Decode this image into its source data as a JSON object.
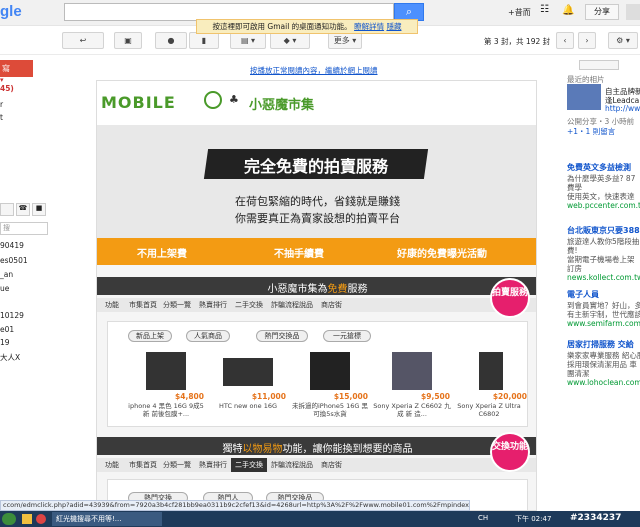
{
  "header": {
    "logo": "gle",
    "plus": "+昔而",
    "share": "分享",
    "search_icon": "search-icon"
  },
  "notice": {
    "text": "按這裡即可啟用 Gmail 的桌面通知功能。",
    "more": "瞭解詳情",
    "hide": "隱藏"
  },
  "toolbar": {
    "more": "更多",
    "range": "第 3 封，共 192 封"
  },
  "left": {
    "compose": "寫",
    "count": "45)",
    "items": [
      "r",
      "t",
      "",
      "90419",
      "es0501",
      "_an",
      "ue",
      "",
      "10129",
      "e01",
      "19",
      "大人X"
    ],
    "search_placeholder": "搜"
  },
  "banner_link": "按播放正常閱讀內容，繼續於網上閱讀",
  "promo": {
    "brand": "MOBILE",
    "brand_sub": "小惡魔市集",
    "hero_title": "完全免費的拍賣服務",
    "hero_line1": "在荷包緊縮的時代，省錢就是賺錢",
    "hero_line2": "你需要真正為賣家設想的拍賣平台",
    "benefits": [
      "不用上架費",
      "不抽手續費",
      "好康的免費曝光活動"
    ],
    "section1_title_pre": "小惡魔市集為",
    "section1_title_hl": "免費",
    "section1_title_post": "服務",
    "section1_badge": "拍賣服務",
    "nav1": [
      "功能",
      "市集首頁",
      "分類一覽",
      "熱賣排行",
      "二手交換",
      "詐騙流程說品",
      "商店街"
    ],
    "tabs": [
      "新品上架",
      "人氣商品",
      "熱門交換品",
      "一元搶標"
    ],
    "products": [
      {
        "price": "$4,800",
        "name": "iphone 4 黑色 16G 9成5新 前後包膜+..."
      },
      {
        "price": "$11,000",
        "name": "HTC new one 16G"
      },
      {
        "price": "$15,000",
        "name": "未拆過的iPhone5 16G 黑可換5s水貨"
      },
      {
        "price": "$9,500",
        "name": "Sony Xperia Z C6602 九成 新 造..."
      },
      {
        "price": "$20,000",
        "name": "Sony Xperia Z Ultra C6802"
      }
    ],
    "section2_title_pre": "獨特",
    "section2_title_hl": "以物易物",
    "section2_title_post": "功能，讓你能換到想要的商品",
    "section2_badge": "交換功能",
    "nav2": [
      "功能",
      "市集首頁",
      "分類一覽",
      "熱賣排行",
      "二手交換",
      "詐騙流程說品",
      "商店街"
    ],
    "tabs2": [
      "熱門交換",
      "熱門人",
      "熱門交換品"
    ]
  },
  "right": {
    "recent": "最近的相片",
    "user": "自主品牌新",
    "user2": "逢Leadca 3",
    "http": "http://ww",
    "share": "公開分享・3 小時前",
    "plus1": "+1・1 則留言",
    "ads": [
      {
        "title": "免費英文多益檢測",
        "lines": [
          "為什麼學英多益? 87",
          "費學",
          "使用英文，快速表達"
        ],
        "url": "web.pccenter.com.tw"
      },
      {
        "title": "台北販東京只要388",
        "lines": [
          "旅遊達人教你5階段抽",
          "費!",
          "當期電子機場卷上架",
          "訂房"
        ],
        "url": "news.kollect.com.tw"
      },
      {
        "title": "電子人員",
        "lines": [
          "到會員實地？好山，多",
          "有主新宇制，世代應該"
        ],
        "url": "www.semifarm.com.tw"
      },
      {
        "title": "居家打掃服務 交給",
        "lines": [
          "樂家家專業服務 紹心服",
          "採用環保清潔用品 車",
          "團清潔"
        ],
        "url": "www.lohoclean.com"
      }
    ]
  },
  "status": "ccom/edmclick.php?adid=43939&from=7920a3b4cf281bb9ea0311b9c2cfef13&id=4268url=http%3A%2F%2Fwww.mobile01.com%2Fmpindex.php",
  "taskbar": {
    "task": "紅光機搜尋不用等!...",
    "ime": "CH",
    "time": "下午 02:47",
    "watermark": "#2334237"
  }
}
